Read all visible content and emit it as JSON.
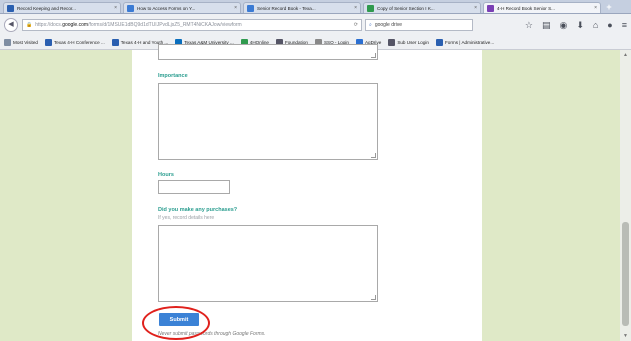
{
  "browser": {
    "tabs": [
      {
        "title": "Record Keeping and Recor...",
        "favicon_color": "#2a5fb0"
      },
      {
        "title": "How to Access Forms on Y...",
        "favicon_color": "#3b7bd4"
      },
      {
        "title": "Senior Record Book - Texa...",
        "favicon_color": "#3b7bd4"
      },
      {
        "title": "Copy of Senior Section I K...",
        "favicon_color": "#2f9a4e"
      },
      {
        "title": "4-H Record Book Senior S...",
        "favicon_color": "#7a3fb5"
      }
    ],
    "new_tab": "+",
    "url_prefix": "https://docs.",
    "url_domain": "google.com",
    "url_rest": "/forms/d/1MSUE1dBQ9d1dTUIJPvdLjsZ5_RMT4NiCKAJow/viewform",
    "search_value": "google drive",
    "bookmarks": [
      {
        "label": "Most Visited",
        "color": "#7f8ea3"
      },
      {
        "label": "Texas 4-H Conference ...",
        "color": "#2a5fb0"
      },
      {
        "label": "Texas 4-H and Youth ...",
        "color": "#2a5fb0"
      },
      {
        "label": "Texas A&M University ...",
        "color": "#0a6ebd"
      },
      {
        "label": "4HOnline",
        "color": "#2f9a4e"
      },
      {
        "label": "Foundation",
        "color": "#556"
      },
      {
        "label": "SSO - Login",
        "color": "#888"
      },
      {
        "label": "AgDrive",
        "color": "#2b6fd1"
      },
      {
        "label": "Sub User Login",
        "color": "#556"
      },
      {
        "label": "Forms | Administrative...",
        "color": "#2a5fb0"
      }
    ]
  },
  "form": {
    "importance_label": "Importance",
    "hours_label": "Hours",
    "purchases_label": "Did you make any purchases?",
    "purchases_help": "If yes, record details here",
    "submit_label": "Submit",
    "footnote": "Never submit passwords through Google Forms."
  },
  "colors": {
    "accent": "#2a9d8f",
    "submit": "#3b82d6",
    "highlight": "#e0211c",
    "page_bg": "#dfe9c7"
  }
}
